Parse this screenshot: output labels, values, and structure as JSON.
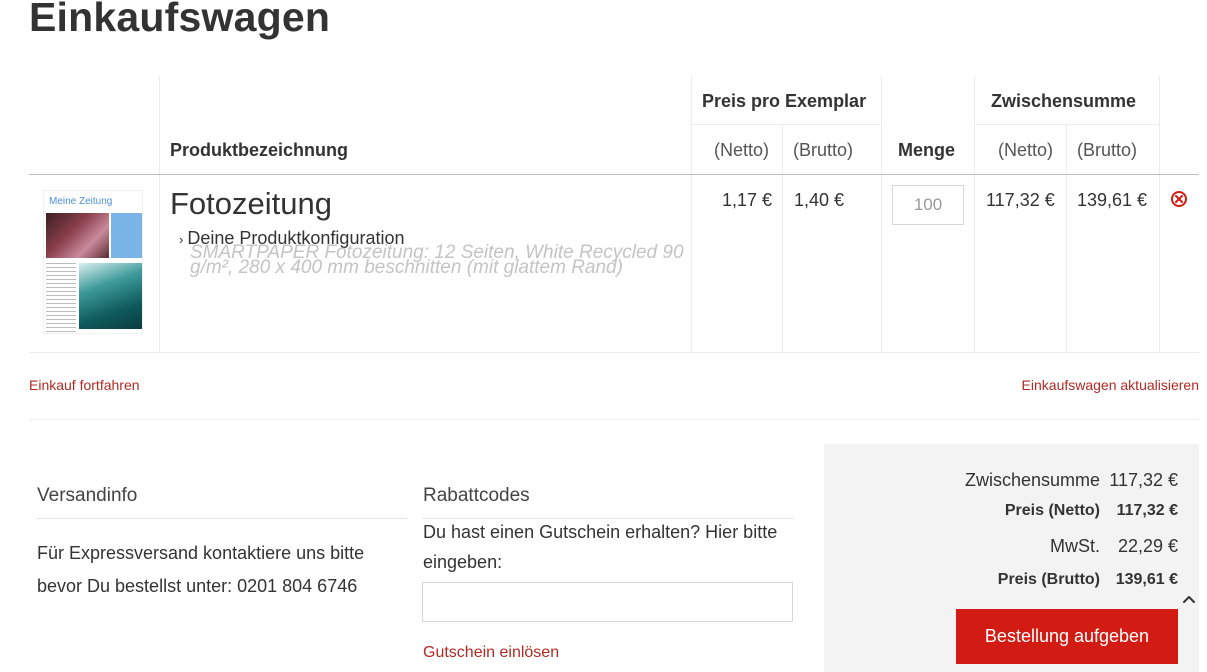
{
  "page": {
    "title": "Einkaufswagen"
  },
  "table": {
    "headers": {
      "product": "Produktbezeichnung",
      "price_group": "Preis pro Exemplar",
      "quantity": "Menge",
      "subtotal_group": "Zwischensumme",
      "net": "(Netto)",
      "gross": "(Brutto)"
    },
    "item": {
      "thumbnail_title": "Meine Zeitung",
      "name": "Fotozeitung",
      "config_toggle": "Deine Produktkonfiguration",
      "config_details": "SMARTPAPER Fotozeitung: 12 Seiten, White Recycled 90 g/m², 280 x 400 mm beschnitten (mit glattem Rand)",
      "price_net": "1,17 €",
      "price_gross": "1,40 €",
      "quantity": "100",
      "subtotal_net": "117,32 €",
      "subtotal_gross": "139,61 €",
      "remove_icon": "remove-circle-icon"
    }
  },
  "actions": {
    "continue_shopping": "Einkauf fortfahren",
    "update_cart": "Einkaufswagen aktualisieren"
  },
  "shipping": {
    "title": "Versandinfo",
    "text": "Für Expressversand kontaktiere uns bitte bevor Du bestellst unter: 0201 804 6746"
  },
  "coupon": {
    "title": "Rabattcodes",
    "text": "Du hast einen Gutschein erhalten? Hier bitte eingeben:",
    "input_value": "",
    "input_placeholder": "",
    "redeem": "Gutschein einlösen"
  },
  "totals": {
    "subtotal_label": "Zwischensumme",
    "subtotal_value": "117,32 €",
    "net_label": "Preis (Netto)",
    "net_value": "117,32 €",
    "tax_label": "MwSt.",
    "tax_value": "22,29 €",
    "gross_label": "Preis (Brutto)",
    "gross_value": "139,61 €",
    "order_button": "Bestellung aufgeben"
  },
  "colors": {
    "link": "#b22a24",
    "primary_button": "#d21c13",
    "totals_bg": "#f3f3f3"
  },
  "icons": {
    "scroll_top": "chevron-up-icon",
    "config_toggle": "chevron-right-icon"
  }
}
